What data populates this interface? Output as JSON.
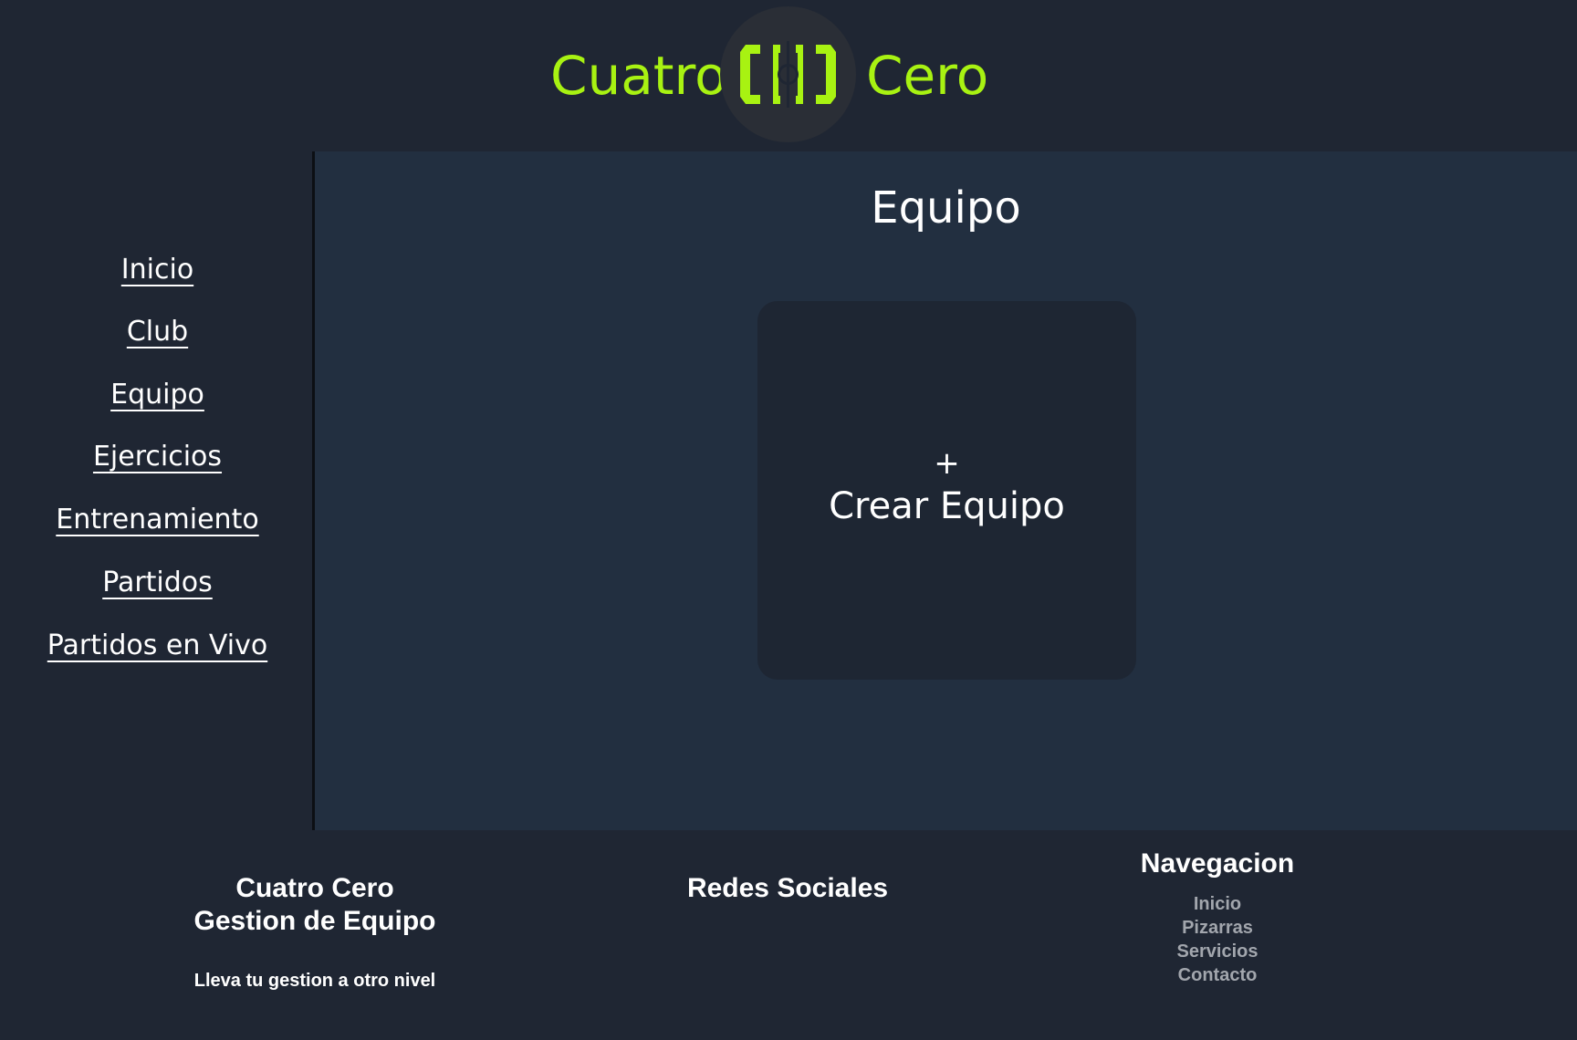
{
  "header": {
    "brand_left": "Cuatro",
    "brand_right": "Cero",
    "logo_icon": "cuatro-cero-logo",
    "accent_color": "#a8f212"
  },
  "sidebar": {
    "items": [
      {
        "label": "Inicio"
      },
      {
        "label": "Club"
      },
      {
        "label": "Equipo"
      },
      {
        "label": "Ejercicios"
      },
      {
        "label": "Entrenamiento"
      },
      {
        "label": "Partidos"
      },
      {
        "label": "Partidos en Vivo"
      }
    ]
  },
  "main": {
    "title": "Equipo",
    "create_card": {
      "icon": "+",
      "label": "Crear Equipo"
    }
  },
  "footer": {
    "brand": {
      "line1": "Cuatro Cero",
      "line2": "Gestion de Equipo",
      "tagline": "Lleva tu gestion a otro nivel"
    },
    "social_title": "Redes Sociales",
    "navigation": {
      "title": "Navegacion",
      "links": [
        "Inicio",
        "Pizarras",
        "Servicios",
        "Contacto"
      ]
    }
  }
}
